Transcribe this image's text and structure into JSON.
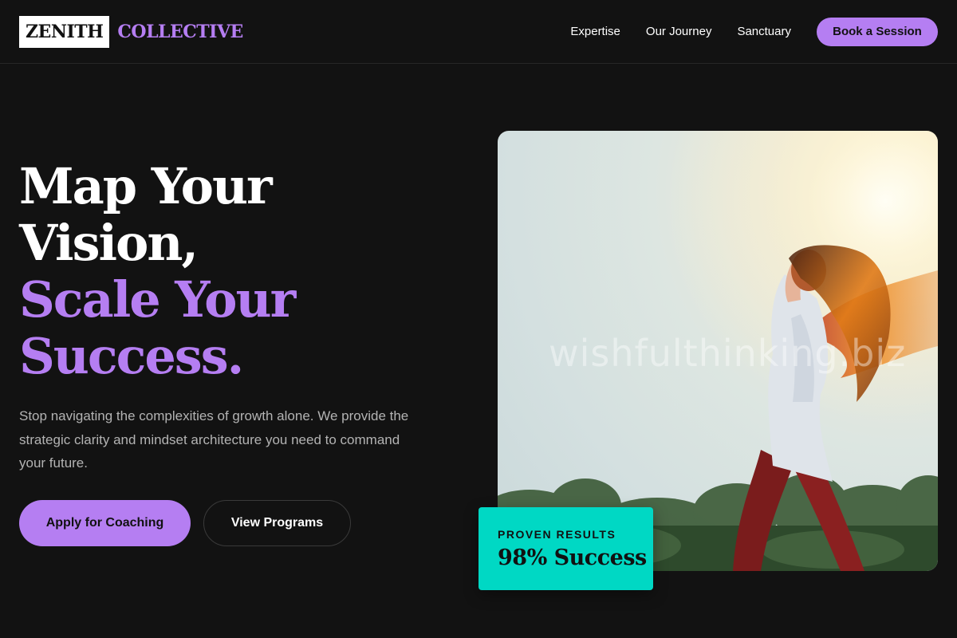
{
  "colors": {
    "accent": "#b57ef2",
    "card": "#00d8c4",
    "background": "#121212"
  },
  "header": {
    "logo_box": "ZENITH",
    "logo_word": "COLLECTIVE",
    "nav": [
      "Expertise",
      "Our Journey",
      "Sanctuary"
    ],
    "cta": "Book a Session"
  },
  "hero": {
    "title_line1": "Map Your",
    "title_line2": "Vision,",
    "title_line3": "Scale Your",
    "title_line4": "Success.",
    "description": "Stop navigating the complexities of growth alone. We provide the strategic clarity and mindset architecture you need to command your future.",
    "primary_button": "Apply for Coaching",
    "secondary_button": "View Programs"
  },
  "image": {
    "watermark": "wishfulthinking.biz"
  },
  "stat": {
    "label": "PROVEN RESULTS",
    "value": "98% Success"
  }
}
